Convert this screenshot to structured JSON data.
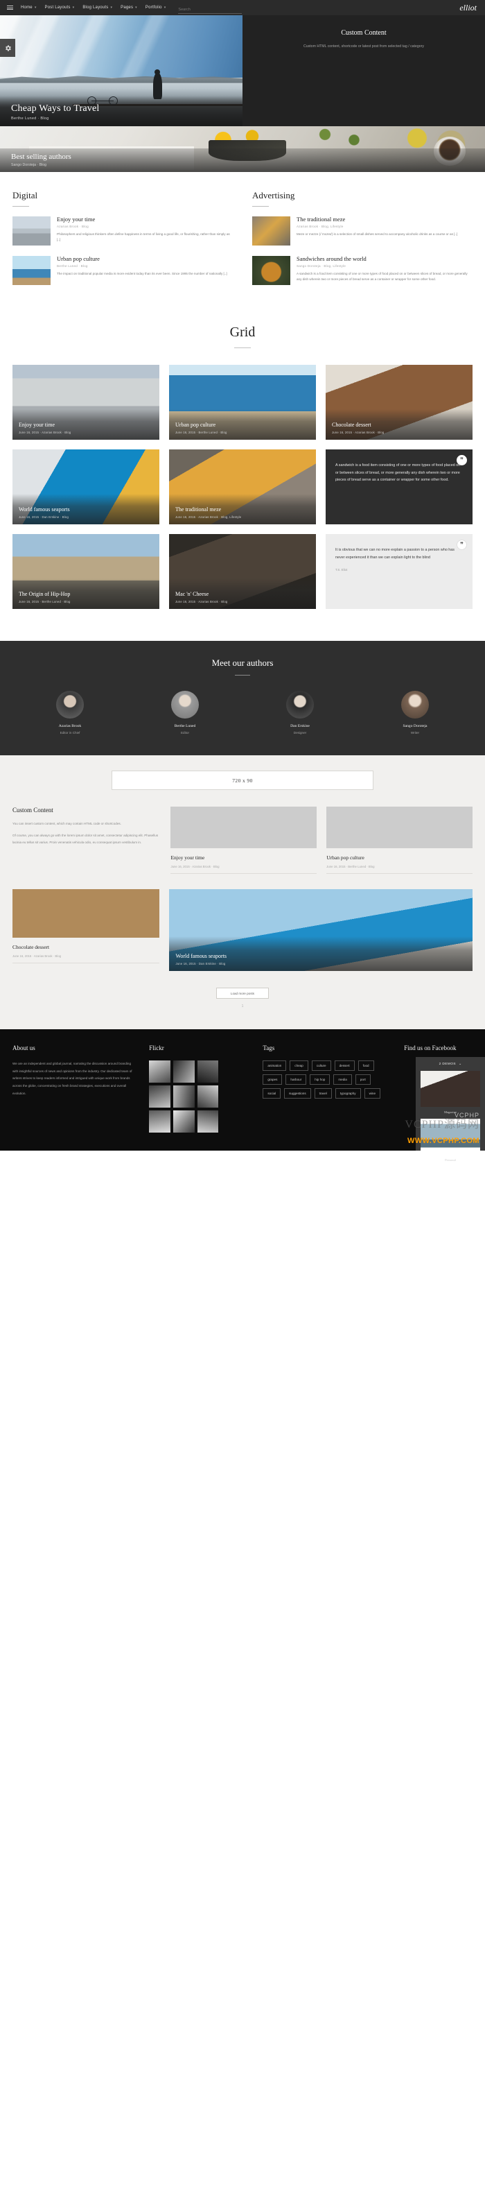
{
  "nav": {
    "menu_icon": "hamburger-icon",
    "items": [
      {
        "label": "Home",
        "has_dropdown": true
      },
      {
        "label": "Post Layouts",
        "has_dropdown": true
      },
      {
        "label": "Blog Layouts",
        "has_dropdown": true
      },
      {
        "label": "Pages",
        "has_dropdown": true
      },
      {
        "label": "Portfolio",
        "has_dropdown": true
      }
    ],
    "search_placeholder": "Search",
    "search_value": "",
    "brand": "elliot"
  },
  "hero": {
    "settings_icon": "gear-icon",
    "featured": {
      "title": "Cheap Ways to Travel",
      "meta": "Berthe Luned  ·  Blog"
    },
    "custom": {
      "title": "Custom Content",
      "text": "Custom HTML content, shortcode or latest post from selected tag / category"
    },
    "second": {
      "title": "Best selling authors",
      "meta": "Sango Doroteja  ·  Blog"
    }
  },
  "categories": [
    {
      "heading": "Digital",
      "posts": [
        {
          "title": "Enjoy your time",
          "meta": "Azarias Brook  ·  Blog",
          "excerpt": "Philosophers and religious thinkers often define happiness in terms of living a good life, or flourishing, rather than simply as [..]",
          "thumb_class": "th-skate"
        },
        {
          "title": "Urban pop culture",
          "meta": "Berthe Luned  ·  Blog",
          "excerpt": "The impact on traditional popular media is more evident today than its ever been. Since 1995 the number of nationally [..]",
          "thumb_class": "th-graf"
        }
      ]
    },
    {
      "heading": "Advertising",
      "posts": [
        {
          "title": "The traditional meze",
          "meta": "Azarias Brook  ·  Blog, Lifestyle",
          "excerpt": "Meze or mezze (/ˈmɛzeɪ/) is a selection of small dishes served to accompany alcoholic drinks as a course or as [..]",
          "thumb_class": "th-meze"
        },
        {
          "title": "Sandwiches around the world",
          "meta": "Sango Doroteja  ·  Blog, Lifestyle",
          "excerpt": "A sandwich is a food item consisting of one or more types of food placed on or between slices of bread, or more generally any dish wherein two or more pieces of bread serve as a container or wrapper for some other food.",
          "thumb_class": "th-sand"
        }
      ]
    }
  ],
  "grid": {
    "heading": "Grid",
    "cards": [
      {
        "kind": "image",
        "title": "Enjoy your time",
        "meta": "June 16, 2015  ·  Azarias Brook  ·  Blog",
        "img": "i-skate"
      },
      {
        "kind": "image",
        "title": "Urban pop culture",
        "meta": "June 16, 2015  ·  Berthe Luned  ·  Blog",
        "img": "i-graf"
      },
      {
        "kind": "image",
        "title": "Chocolate dessert",
        "meta": "June 16, 2015  ·  Azarias Brook  ·  Blog",
        "img": "i-choc"
      },
      {
        "kind": "image",
        "title": "World famous seaports",
        "meta": "June 16, 2015  ·  Dan Erskine  ·  Blog",
        "img": "i-port"
      },
      {
        "kind": "image",
        "title": "The traditional meze",
        "meta": "June 16, 2015  ·  Azarias Brook  ·  Blog, Lifestyle",
        "img": "i-meze2"
      },
      {
        "kind": "quote",
        "theme": "dark",
        "quote_icon": "quote-mark-icon",
        "body": "A sandwich is a food item consisting of one or more types of food placed on or between slices of bread, or more generally any dish wherein two or more pieces of bread serve as a container or wrapper for some other food.",
        "meta": ""
      },
      {
        "kind": "image",
        "title": "The Origin of Hip-Hop",
        "meta": "June 16, 2015  ·  Berthe Luned  ·  Blog",
        "img": "i-hiphop"
      },
      {
        "kind": "image",
        "title": "Mac 'n' Cheese",
        "meta": "June 16, 2015  ·  Azarias Brook  ·  Blog",
        "img": "i-mac"
      },
      {
        "kind": "quote",
        "theme": "light",
        "quote_icon": "quote-mark-icon",
        "body": "It is obvious that we can no more explain a passion to a person who has never experienced it than we can explain light to the blind",
        "meta": "T.S. Eliot"
      }
    ]
  },
  "authors": {
    "heading": "Meet our authors",
    "people": [
      {
        "name": "Azarias Brook",
        "role": "Editor in Chief",
        "avatar": "a1"
      },
      {
        "name": "Berthe Luned",
        "role": "Editor",
        "avatar": "a2"
      },
      {
        "name": "Dan Erskine",
        "role": "Designer",
        "avatar": "a3"
      },
      {
        "name": "Sango Doroteja",
        "role": "Writer",
        "avatar": "a4"
      }
    ]
  },
  "lower": {
    "banner_label": "720 x 90",
    "custom": {
      "heading": "Custom Content",
      "paragraphs": [
        "You can insert custom content, which may contain HTML code or shortcodes.",
        "Of course, you can always go with the lorem ipsum dolor sit amet, consectetur adipiscing elit. Phasellus lacinia eu tellus sit varius. Proin venenatis vehicula odio, eu consequat ipsum vestibulum in."
      ]
    },
    "minis": [
      {
        "title": "Enjoy your time",
        "meta": "June 16, 2015  ·  Azarias Brook  ·  Blog",
        "img": "i-skate"
      },
      {
        "title": "Urban pop culture",
        "meta": "June 16, 2015  ·  Berthe Luned  ·  Blog",
        "img": "i-graf"
      }
    ],
    "big_left": {
      "title": "Chocolate dessert",
      "meta": "June 16, 2015  ·  Azarias Brook  ·  Blog",
      "img": "i-choc"
    },
    "big_right": {
      "title": "World famous seaports",
      "meta": "June 16, 2015  ·  Dan Erskine  ·  Blog",
      "img": "i-plane"
    },
    "load_more": "Load more posts",
    "pager": "1"
  },
  "footer": {
    "about": {
      "heading": "About us",
      "text": "We are an independent and global journal, narrating the discussion around branding with insightful sources of news and opinions from the industry. Our dedicated team of writers strives to keep readers informed and intrigued with unique work from brands across the globe, concentrating on fresh brand strategies, executions and overall evolution."
    },
    "flickr": {
      "heading": "Flickr",
      "count": 9
    },
    "tags": {
      "heading": "Tags",
      "items": [
        "animation",
        "cheap",
        "culture",
        "dessert",
        "food",
        "grapes",
        "harbour",
        "hip hop",
        "media",
        "port",
        "social",
        "suggestions",
        "travel",
        "typography",
        "wine"
      ]
    },
    "facebook": {
      "heading": "Find us on Facebook",
      "panel_label": "2 DEMOS",
      "chevron": "chevron-down-icon",
      "demo1": "Magazine",
      "demo2": "Personal"
    },
    "watermark_cn": "VCPHP源码网",
    "watermark_top": "VCPHP",
    "watermark_url": "WWW.VCPHP.COM"
  }
}
